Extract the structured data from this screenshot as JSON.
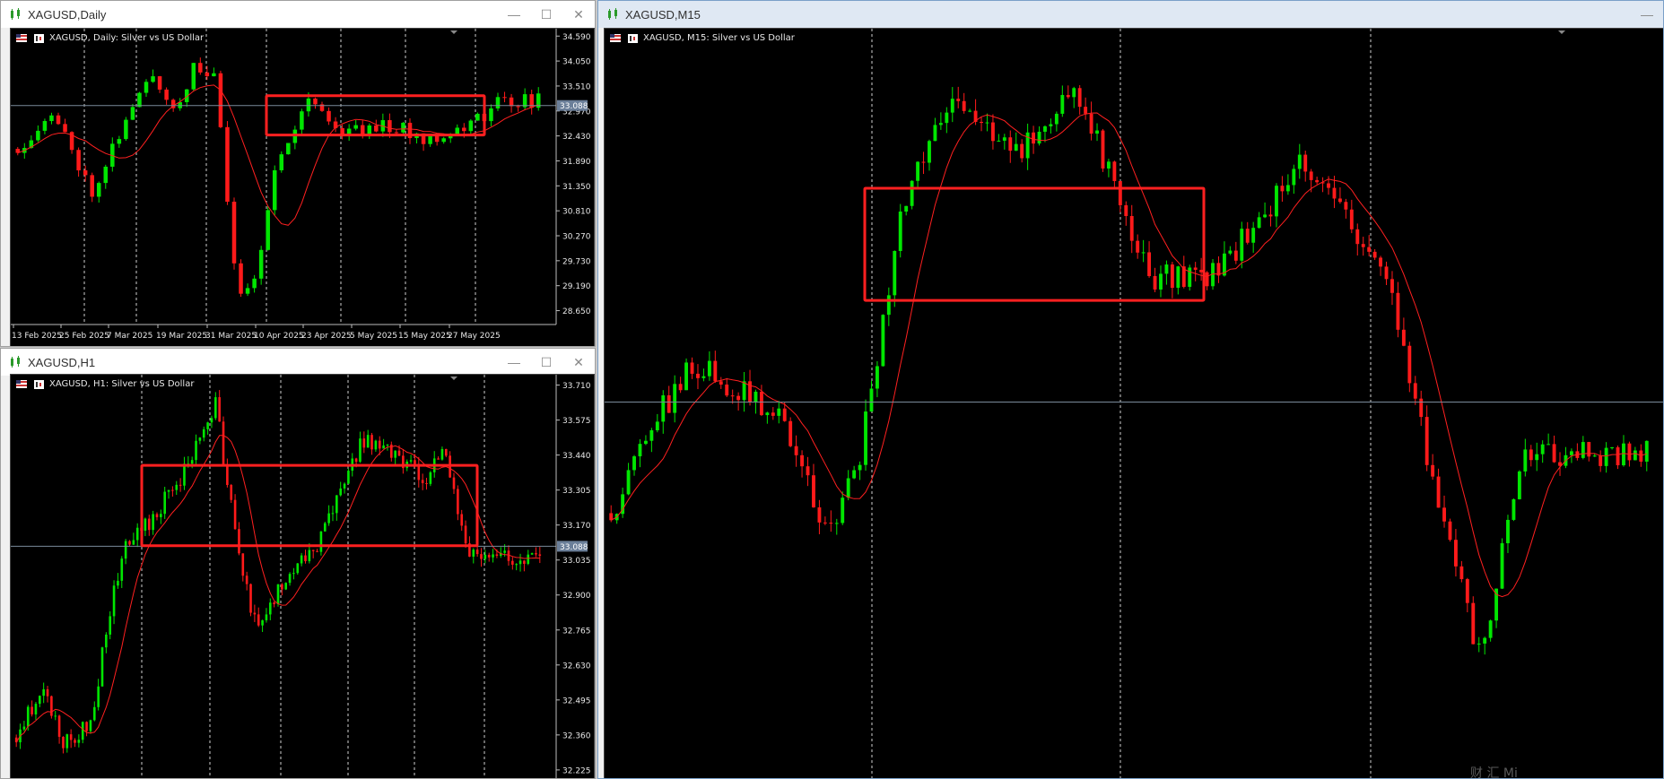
{
  "windows": {
    "daily": {
      "title": "XAGUSD,Daily",
      "chart_label": "XAGUSD, Daily:  Silver vs US Dollar"
    },
    "h1": {
      "title": "XAGUSD,H1",
      "chart_label": "XAGUSD, H1:  Silver vs US Dollar"
    },
    "m15": {
      "title": "XAGUSD,M15",
      "chart_label": "XAGUSD, M15:  Silver vs US Dollar",
      "watermark": "财 汇 Mi"
    }
  },
  "window_buttons": {
    "minimize": "—",
    "maximize": "☐",
    "close": "✕"
  },
  "colors": {
    "chart_bg": "#000000",
    "bull": "#00e600",
    "bear": "#ff1a1a",
    "ma": "#ff2020",
    "highlight_box": "#ff2020",
    "grid": "#cfcfcf",
    "axis_text": "#e8e8e8",
    "bid_line": "#7a8a9a",
    "price_tag": "#6b7f99"
  },
  "chart_data": [
    {
      "id": "daily",
      "type": "candlestick",
      "symbol": "XAGUSD",
      "title": "XAGUSD, Daily:  Silver vs US Dollar",
      "y_ticks": [
        "34.590",
        "34.050",
        "33.510",
        "32.970",
        "32.430",
        "31.890",
        "31.350",
        "30.810",
        "30.270",
        "29.730",
        "29.190",
        "28.650"
      ],
      "ylim": [
        28.35,
        34.75
      ],
      "x_ticks": [
        "13 Feb 2025",
        "25 Feb 2025",
        "7 Mar 2025",
        "19 Mar 2025",
        "31 Mar 2025",
        "10 Apr 2025",
        "23 Apr 2025",
        "5 May 2025",
        "15 May 2025",
        "27 May 2025"
      ],
      "current_price": "33.088",
      "current_price_value": 33.088,
      "highlight_box": {
        "y_low": 32.45,
        "y_high": 33.3
      },
      "ma_period_hint": "moving average",
      "candles": 78,
      "seed": 11,
      "path": [
        [
          0,
          32.15
        ],
        [
          0.06,
          32.9
        ],
        [
          0.1,
          32.3
        ],
        [
          0.14,
          31.2
        ],
        [
          0.2,
          32.6
        ],
        [
          0.26,
          33.8
        ],
        [
          0.3,
          33.0
        ],
        [
          0.34,
          33.9
        ],
        [
          0.38,
          33.7
        ],
        [
          0.42,
          29.0
        ],
        [
          0.46,
          29.5
        ],
        [
          0.5,
          32.0
        ],
        [
          0.56,
          33.3
        ],
        [
          0.62,
          32.5
        ],
        [
          0.7,
          32.7
        ],
        [
          0.78,
          32.4
        ],
        [
          0.86,
          32.6
        ],
        [
          0.93,
          33.2
        ]
      ],
      "vol": 0.42
    },
    {
      "id": "h1",
      "type": "candlestick",
      "symbol": "XAGUSD",
      "title": "XAGUSD, H1:  Silver vs US Dollar",
      "y_ticks": [
        "33.710",
        "33.575",
        "33.440",
        "33.305",
        "33.170",
        "33.035",
        "32.900",
        "32.765",
        "32.630",
        "32.495",
        "32.360",
        "32.225"
      ],
      "ylim": [
        32.19,
        33.75
      ],
      "x_ticks": [],
      "current_price": "33.088",
      "current_price_value": 33.088,
      "highlight_box": {
        "y_low": 33.09,
        "y_high": 33.4
      },
      "candles": 135,
      "seed": 23,
      "path": [
        [
          0,
          32.35
        ],
        [
          0.05,
          32.55
        ],
        [
          0.09,
          32.32
        ],
        [
          0.14,
          32.4
        ],
        [
          0.2,
          33.05
        ],
        [
          0.26,
          33.2
        ],
        [
          0.33,
          33.4
        ],
        [
          0.38,
          33.65
        ],
        [
          0.42,
          33.1
        ],
        [
          0.46,
          32.75
        ],
        [
          0.52,
          33.0
        ],
        [
          0.58,
          33.1
        ],
        [
          0.62,
          33.3
        ],
        [
          0.66,
          33.5
        ],
        [
          0.72,
          33.45
        ],
        [
          0.78,
          33.35
        ],
        [
          0.82,
          33.45
        ],
        [
          0.86,
          33.1
        ],
        [
          0.87,
          33.05
        ]
      ],
      "vol": 0.09
    },
    {
      "id": "m15",
      "type": "candlestick",
      "symbol": "XAGUSD",
      "title": "XAGUSD, M15:  Silver vs US Dollar",
      "y_ticks": [],
      "ylim": [
        32.45,
        33.72
      ],
      "x_ticks": [],
      "current_price": "",
      "current_price_value": 33.088,
      "highlight_box": {
        "y_low": 33.26,
        "y_high": 33.45
      },
      "candles": 180,
      "seed": 37,
      "path": [
        [
          0,
          32.9
        ],
        [
          0.04,
          33.05
        ],
        [
          0.08,
          33.15
        ],
        [
          0.13,
          33.1
        ],
        [
          0.17,
          33.05
        ],
        [
          0.21,
          32.85
        ],
        [
          0.24,
          33.0
        ],
        [
          0.28,
          33.4
        ],
        [
          0.33,
          33.62
        ],
        [
          0.39,
          33.5
        ],
        [
          0.45,
          33.62
        ],
        [
          0.52,
          33.3
        ],
        [
          0.58,
          33.3
        ],
        [
          0.63,
          33.4
        ],
        [
          0.66,
          33.5
        ],
        [
          0.7,
          33.42
        ],
        [
          0.75,
          33.3
        ],
        [
          0.8,
          32.9
        ],
        [
          0.84,
          32.65
        ],
        [
          0.88,
          33.0
        ]
      ],
      "vol": 0.06
    }
  ]
}
